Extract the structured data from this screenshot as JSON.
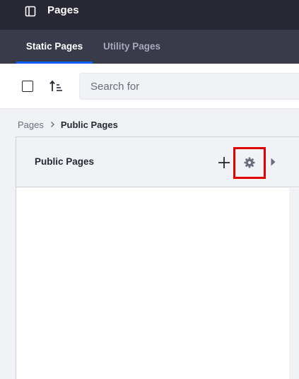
{
  "header": {
    "title": "Pages",
    "panel_toggle_icon": "panel-toggle-icon",
    "background": "#272833"
  },
  "tabs": [
    {
      "label": "Static Pages",
      "active": true
    },
    {
      "label": "Utility Pages",
      "active": false
    }
  ],
  "toolbar": {
    "select_all_checked": false,
    "sort_icon": "sort-ascending-icon",
    "search": {
      "placeholder": "Search for",
      "value": ""
    }
  },
  "breadcrumb": {
    "root": "Pages",
    "current": "Public Pages",
    "separator_icon": "chevron-right-icon"
  },
  "column": {
    "title": "Public Pages",
    "add_icon": "plus-icon",
    "settings_icon": "gear-icon",
    "expand_icon": "caret-right-icon",
    "highlight_color": "#e00000"
  },
  "colors": {
    "accent": "#0b5fff",
    "tab_bar": "#393a4a",
    "page_bg": "#f1f2f5"
  }
}
